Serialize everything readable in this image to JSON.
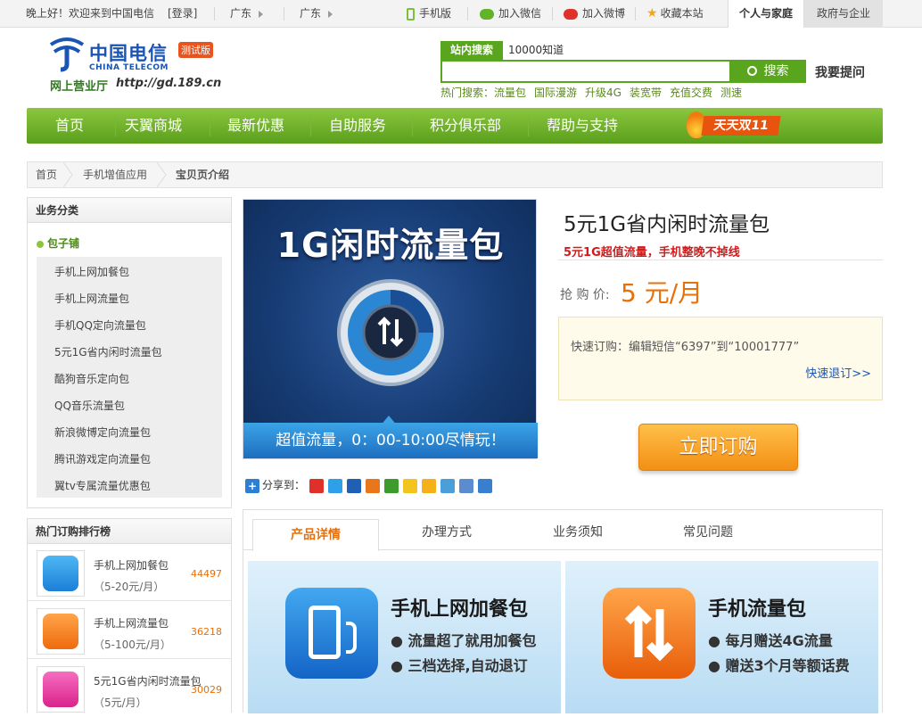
{
  "topbar": {
    "greeting": "晚上好！欢迎来到中国电信",
    "login": "[登录]",
    "region1": "广东",
    "region2": "广东",
    "mobile": "手机版",
    "wechat": "加入微信",
    "weibo": "加入微博",
    "favorite": "收藏本站",
    "personal_tab": "个人与家庭",
    "gov_tab": "政府与企业"
  },
  "logo": {
    "cn": "中国电信",
    "en": "CHINA TELECOM",
    "badge": "测试版",
    "subtitle": "网上营业厅",
    "url": "http://gd.189.cn"
  },
  "search": {
    "tab_active": "站内搜索",
    "tab_other": "10000知道",
    "button": "搜索",
    "ask": "我要提问",
    "hot_label": "热门搜索：",
    "hot_terms": [
      "流量包",
      "国际漫游",
      "升级4G",
      "装宽带",
      "充值交费",
      "测速"
    ]
  },
  "nav": {
    "items": [
      "首页",
      "天翼商城",
      "最新优惠",
      "自助服务",
      "积分俱乐部",
      "帮助与支持"
    ],
    "promo": "天天双11"
  },
  "breadcrumb": [
    "首页",
    "手机增值应用",
    "宝贝页介绍"
  ],
  "sidebar": {
    "title": "业务分类",
    "category": "包子铺",
    "items": [
      "手机上网加餐包",
      "手机上网流量包",
      "手机QQ定向流量包",
      "5元1G省内闲时流量包",
      "酷狗音乐定向包",
      "QQ音乐流量包",
      "新浪微博定向流量包",
      "腾讯游戏定向流量包",
      "翼tv专属流量优惠包"
    ]
  },
  "hotrank": {
    "title": "热门订购排行榜",
    "items": [
      {
        "name": "手机上网加餐包",
        "price": "（5-20元/月）",
        "count": "44497"
      },
      {
        "name": "手机上网流量包",
        "price": "（5-100元/月）",
        "count": "36218"
      },
      {
        "name": "5元1G省内闲时流量包",
        "price": "（5元/月）",
        "count": "30029"
      }
    ]
  },
  "product": {
    "image_title": "1G闲时流量包",
    "image_strip": "超值流量，0：00-10:00尽情玩！",
    "share_label": "分享到：",
    "name": "5元1G省内闲时流量包",
    "slogan": "5元1G超值流量，手机整晚不掉线",
    "price_label": "抢 购 价:",
    "price": "5 元/月",
    "quick_order": "快速订购：编辑短信“6397”到“10001777”",
    "quick_cancel": "快速退订>>",
    "buy_button": "立即订购"
  },
  "tabs": {
    "items": [
      "产品详情",
      "办理方式",
      "业务须知",
      "常见问题"
    ]
  },
  "banners": [
    {
      "title": "手机上网加餐包",
      "line1": "● 流量超了就用加餐包",
      "line2": "● 三档选择,自动退订"
    },
    {
      "title": "手机流量包",
      "line1": "● 每月赠送4G流量",
      "line2": "● 赠送3个月等额话费"
    }
  ],
  "colors": {
    "brand_green": "#5aa51e",
    "accent_orange": "#e8700a",
    "telecom_blue": "#1a55b4",
    "slogan_red": "#d61a1a"
  }
}
